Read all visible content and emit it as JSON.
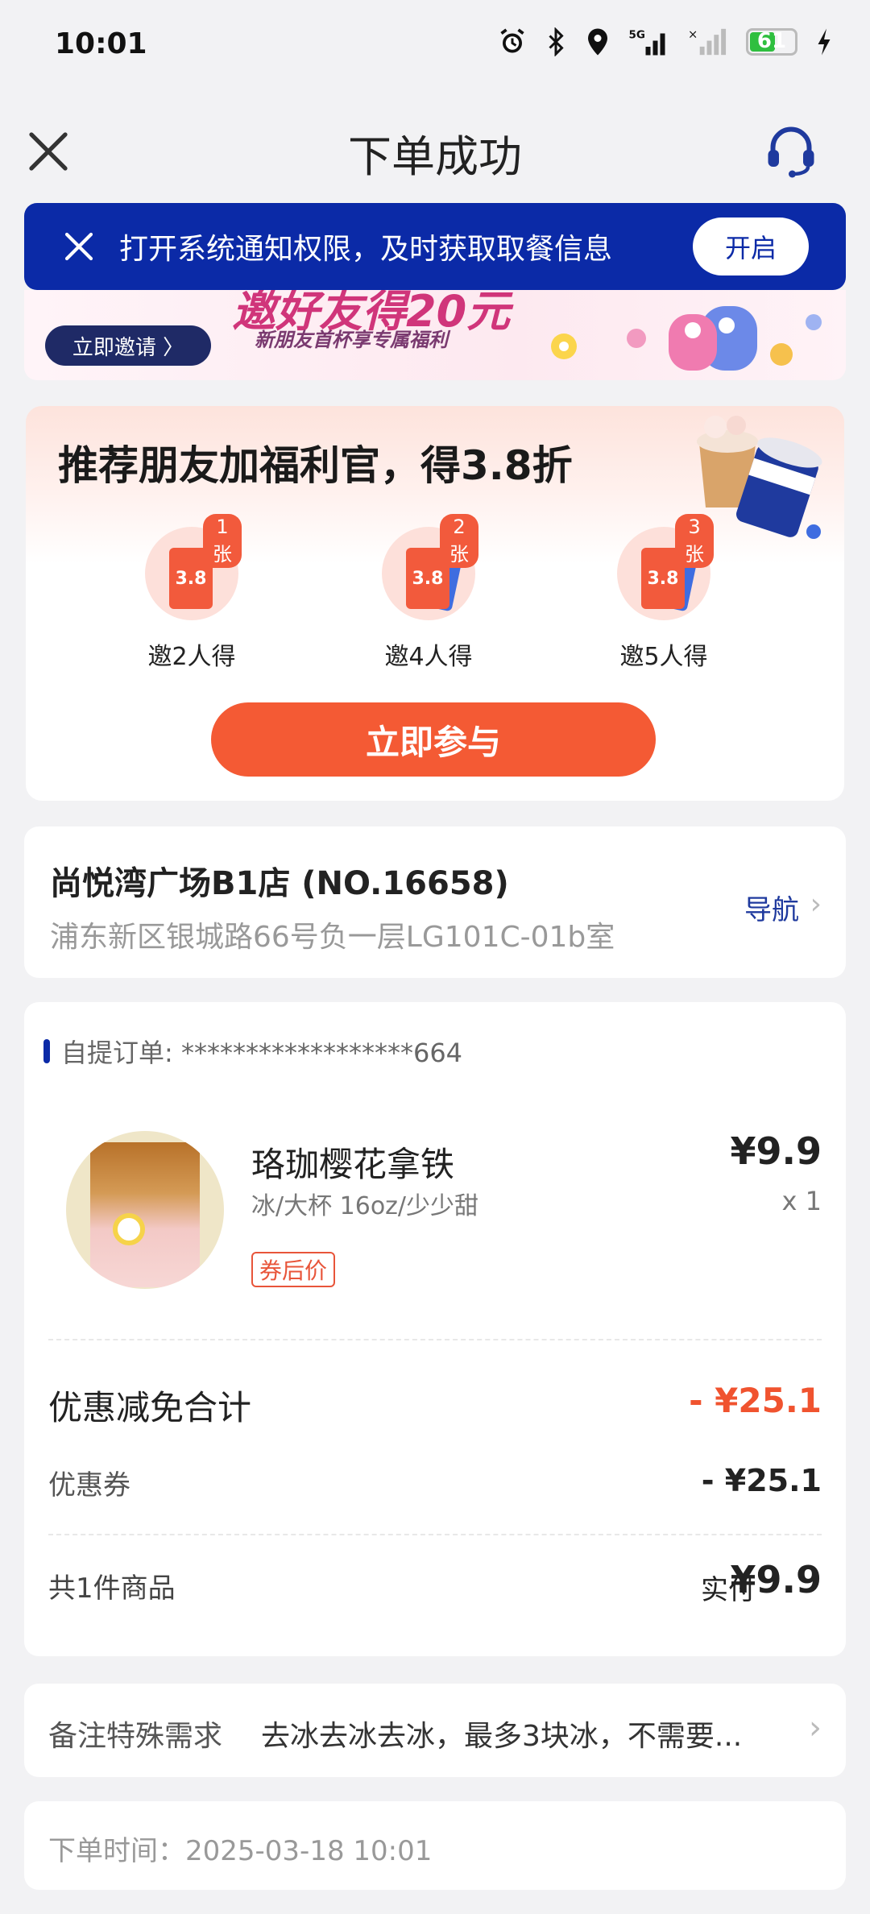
{
  "status_bar": {
    "time": "10:01",
    "battery": "61",
    "battery_level": 0.61,
    "icons": [
      "alarm-icon",
      "bluetooth-icon",
      "location-icon",
      "signal-5g-icon",
      "signal-icon",
      "battery-icon",
      "charging-icon"
    ]
  },
  "nav": {
    "title": "下单成功"
  },
  "notice": {
    "text": "打开系统通知权限，及时获取取餐信息",
    "button": "开启"
  },
  "banner": {
    "headline": "邀好友得20元",
    "sub": "新朋友首杯享专属福利",
    "button": "立即邀请 〉"
  },
  "referral": {
    "title": "推荐朋友加福利官，得3.8折",
    "tiers": [
      {
        "badge": "1张",
        "ticket": "3.8",
        "label": "邀2人得"
      },
      {
        "badge": "2张",
        "ticket": "3.8",
        "label": "邀4人得"
      },
      {
        "badge": "3张",
        "ticket": "3.8",
        "label": "邀5人得"
      }
    ],
    "button": "立即参与"
  },
  "store": {
    "name": "尚悦湾广场B1店 (NO.16658)",
    "address": "浦东新区银城路66号负一层LG101C-01b室",
    "nav_label": "导航",
    "chevron": "›"
  },
  "order": {
    "number": "自提订单: ******************664",
    "product": {
      "name": "珞珈樱花拿铁",
      "spec": "冰/大杯 16oz/少少甜",
      "tag": "券后价",
      "price": "¥9.9",
      "qty": "x 1"
    },
    "discount_label": "优惠减免合计",
    "discount_value": "- ¥25.1",
    "coupon_label": "优惠券",
    "coupon_value": "- ¥25.1",
    "count_label": "共1件商品",
    "paid_label": "实付",
    "paid_value": "¥9.9"
  },
  "remark": {
    "label": "备注特殊需求",
    "text": "去冰去冰去冰，最多3块冰，不需要...",
    "chevron": "›"
  },
  "order_time": {
    "text": "下单时间：2025-03-18 10:01"
  },
  "colors": {
    "brand_blue": "#0b2aa7",
    "accent_orange": "#f45a34",
    "discount_red": "#f0532f"
  }
}
